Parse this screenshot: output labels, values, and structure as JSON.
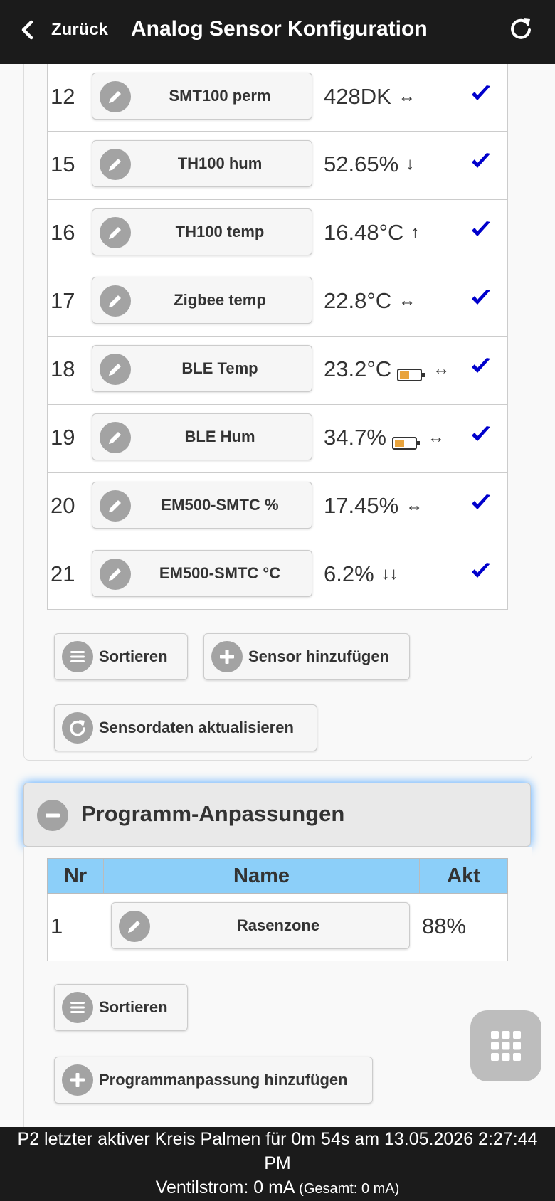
{
  "header": {
    "back_label": "Zurück",
    "title": "Analog Sensor Konfiguration"
  },
  "sensors": [
    {
      "nr": "12",
      "name": "SMT100 perm",
      "value": "428DK",
      "trend": "↔",
      "battery": false
    },
    {
      "nr": "15",
      "name": "TH100 hum",
      "value": "52.65%",
      "trend": "↓",
      "battery": false
    },
    {
      "nr": "16",
      "name": "TH100 temp",
      "value": "16.48°C",
      "trend": "↑",
      "battery": false
    },
    {
      "nr": "17",
      "name": "Zigbee temp",
      "value": "22.8°C",
      "trend": "↔",
      "battery": false
    },
    {
      "nr": "18",
      "name": "BLE Temp",
      "value": "23.2°C",
      "trend": "↔",
      "battery": true
    },
    {
      "nr": "19",
      "name": "BLE Hum",
      "value": "34.7%",
      "trend": "↔",
      "battery": true
    },
    {
      "nr": "20",
      "name": "EM500-SMTC %",
      "value": "17.45%",
      "trend": "↔",
      "battery": false
    },
    {
      "nr": "21",
      "name": "EM500-SMTC °C",
      "value": "6.2%",
      "trend": "↓↓",
      "battery": false
    }
  ],
  "sensor_actions": {
    "sort_label": "Sortieren",
    "add_label": "Sensor hinzufügen",
    "refresh_label": "Sensordaten aktualisieren"
  },
  "program_section": {
    "title": "Programm-Anpassungen",
    "columns": [
      "Nr",
      "Name",
      "Akt"
    ],
    "rows": [
      {
        "nr": "1",
        "name": "Rasenzone",
        "akt": "88%"
      }
    ],
    "sort_label": "Sortieren",
    "add_label": "Programmanpassung hinzufügen"
  },
  "footer": {
    "line1": "P2 letzter aktiver Kreis Palmen für 0m 54s am 13.05.2026 2:27:44",
    "line2": "PM",
    "line3_main": "Ventilstrom: 0 mA",
    "line3_small": "(Gesamt: 0 mA)"
  },
  "colors": {
    "header_bg": "#1b1b1b",
    "table_header_bg": "#8ccff9",
    "check_color": "#0000cc",
    "battery_fill": "#e8a33c",
    "focus_glow": "#4aa3ff"
  }
}
